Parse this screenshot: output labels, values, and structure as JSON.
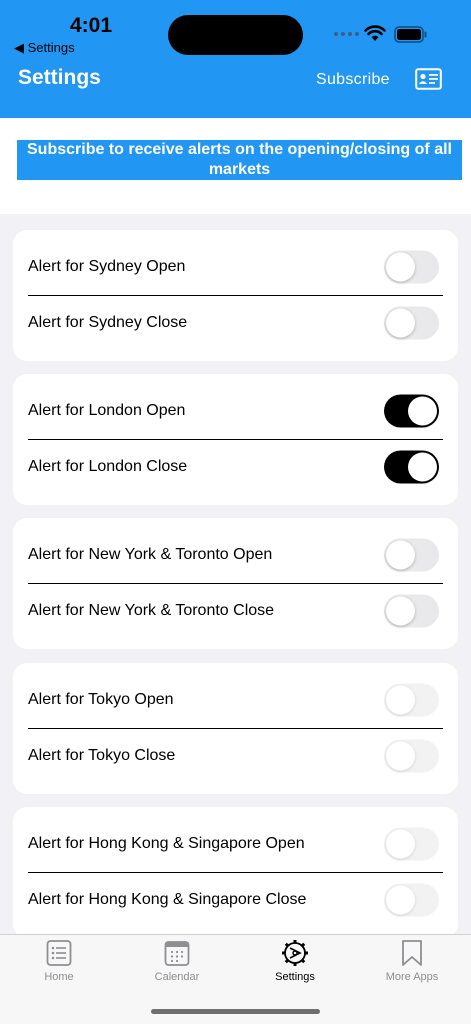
{
  "status": {
    "time": "4:01",
    "back_label": "◀ Settings"
  },
  "header": {
    "title": "Settings",
    "subscribe_label": "Subscribe",
    "contact_icon": "contact-card-icon"
  },
  "banner": {
    "text": "Subscribe to receive alerts on the opening/closing of all markets"
  },
  "markets": [
    {
      "open_label": "Alert for Sydney Open",
      "open_on": false,
      "close_label": "Alert for Sydney Close",
      "close_on": false
    },
    {
      "open_label": "Alert for London Open",
      "open_on": true,
      "close_label": "Alert for London Close",
      "close_on": true
    },
    {
      "open_label": "Alert for New York & Toronto Open",
      "open_on": false,
      "close_label": "Alert for New York & Toronto Close",
      "close_on": false
    },
    {
      "open_label": "Alert for Tokyo Open",
      "open_on": false,
      "close_label": "Alert for Tokyo Close",
      "close_on": false
    },
    {
      "open_label": "Alert for Hong Kong & Singapore Open",
      "open_on": false,
      "close_label": "Alert for Hong Kong & Singapore Close",
      "close_on": false
    }
  ],
  "tabs": [
    {
      "label": "Home",
      "icon": "list-icon",
      "active": false
    },
    {
      "label": "Calendar",
      "icon": "calendar-icon",
      "active": false
    },
    {
      "label": "Settings",
      "icon": "gear-icon",
      "active": true
    },
    {
      "label": "More Apps",
      "icon": "bookmark-icon",
      "active": false
    }
  ],
  "colors": {
    "header_blue": "#2196f3",
    "toggle_on": "#000000",
    "toggle_off": "#e9e9eb"
  }
}
